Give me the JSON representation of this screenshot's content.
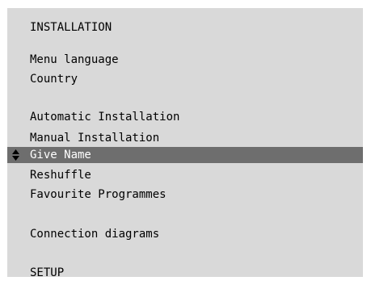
{
  "menu": {
    "title": "INSTALLATION",
    "items": [
      {
        "label": "Menu language",
        "selected": false
      },
      {
        "label": "Country",
        "selected": false
      },
      {
        "label": "Automatic Installation",
        "selected": false
      },
      {
        "label": "Manual Installation",
        "selected": false
      },
      {
        "label": "Give Name",
        "selected": true
      },
      {
        "label": "Reshuffle",
        "selected": false
      },
      {
        "label": "Favourite Programmes",
        "selected": false
      },
      {
        "label": "Connection diagrams",
        "selected": false
      },
      {
        "label": "SETUP",
        "selected": false
      }
    ]
  },
  "colors": {
    "panel_background": "#d9d9d9",
    "highlight_background": "#6e6e6e",
    "text": "#000000",
    "highlight_text": "#ffffff"
  },
  "icons": {
    "selection_cursor": "up-down-arrow-icon"
  }
}
